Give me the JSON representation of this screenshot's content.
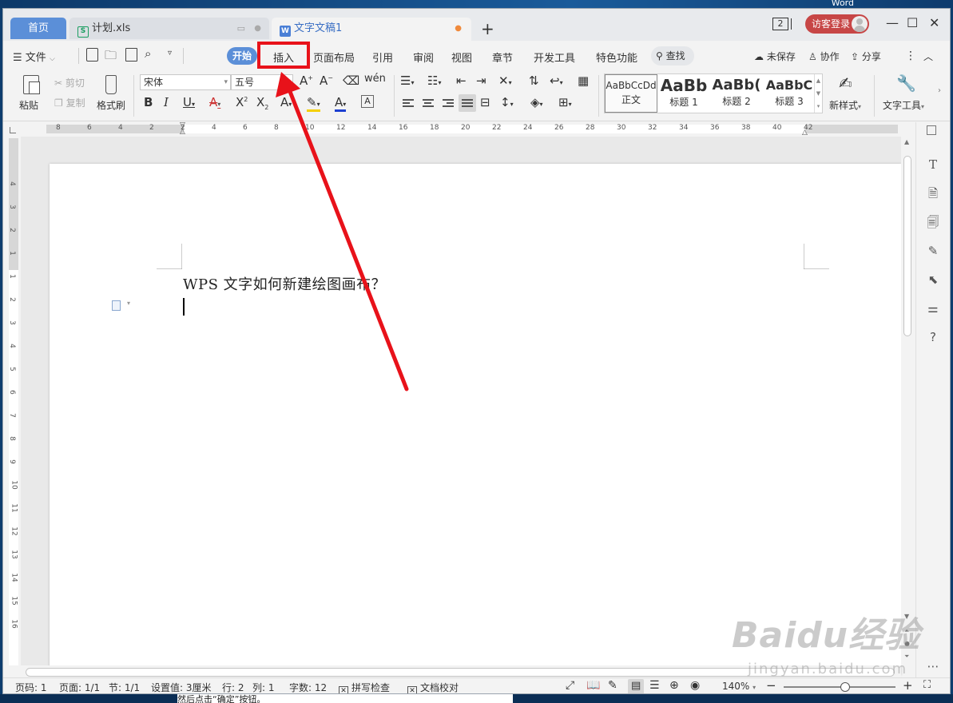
{
  "desktop": {
    "top_label": "Word",
    "under_text": "然后点击“确定”按钮。"
  },
  "tabs": {
    "home": "首页",
    "xls": "计划.xls",
    "doc": "文字文稿1",
    "add": "+",
    "window_count": "2",
    "login": "访客登录"
  },
  "menu": {
    "file": "文件",
    "start": "开始",
    "items": [
      "插入",
      "页面布局",
      "引用",
      "审阅",
      "视图",
      "章节",
      "开发工具",
      "特色功能"
    ],
    "search": "查找",
    "right": [
      "未保存",
      "协作",
      "分享"
    ]
  },
  "ribbon": {
    "paste": "粘贴",
    "cut": "剪切",
    "copy": "复制",
    "format_painter": "格式刷",
    "font_name": "宋体",
    "font_size": "五号",
    "styles": [
      {
        "sample": "AaBbCcDd",
        "name": "正文"
      },
      {
        "sample": "AaBb",
        "name": "标题 1"
      },
      {
        "sample": "AaBb(",
        "name": "标题 2"
      },
      {
        "sample": "AaBbC",
        "name": "标题 3"
      }
    ],
    "new_style": "新样式",
    "text_tools": "文字工具"
  },
  "ruler": {
    "h_numbers": [
      "8",
      "6",
      "4",
      "2",
      "2",
      "4",
      "6",
      "8",
      "10",
      "12",
      "14",
      "16",
      "18",
      "20",
      "22",
      "24",
      "26",
      "28",
      "30",
      "32",
      "34",
      "36",
      "38",
      "40",
      "42"
    ],
    "v_numbers": [
      "4",
      "3",
      "2",
      "1",
      "1",
      "2",
      "3",
      "4",
      "5",
      "6",
      "7",
      "8",
      "9",
      "10",
      "11",
      "12",
      "13",
      "14",
      "15",
      "16"
    ]
  },
  "document": {
    "text": "WPS 文字如何新建绘图画布？"
  },
  "status": {
    "page_num": "页码: 1",
    "pages": "页面: 1/1",
    "section": "节: 1/1",
    "setting": "设置值: 3厘米",
    "row": "行: 2",
    "col": "列: 1",
    "words": "字数: 12",
    "spell": "拼写检查",
    "proof": "文档校对",
    "zoom": "140%",
    "zoom_level_fraction": 0.55
  },
  "watermark": {
    "main": "Baidu经验",
    "sub": "jingyan.baidu.com"
  },
  "colors": {
    "accent": "#5b8fd8",
    "highlight": "#e8121a",
    "login": "#c74646"
  }
}
